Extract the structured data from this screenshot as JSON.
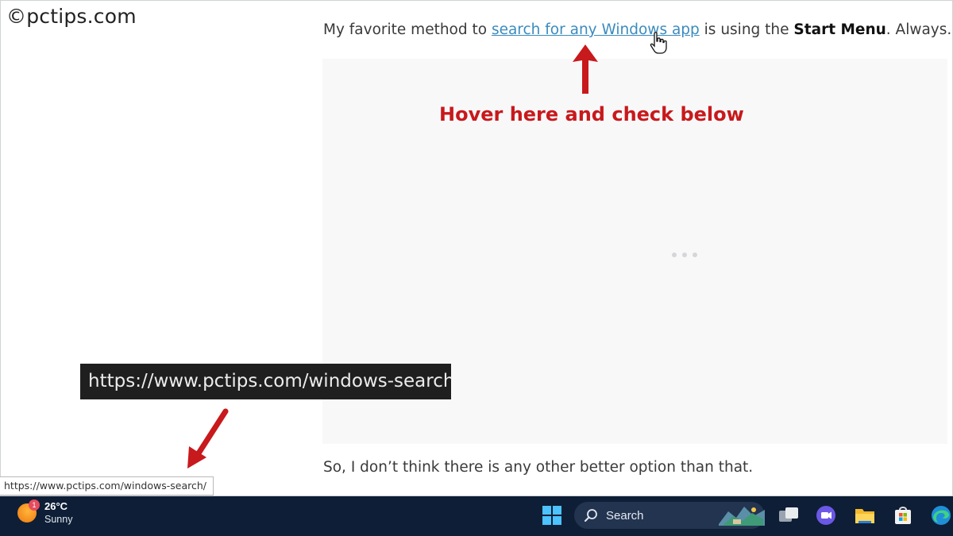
{
  "watermark": "©pctips.com",
  "article": {
    "para1_pre": "My favorite method to ",
    "para1_link": "search for any Windows app",
    "para1_mid": " is using the ",
    "para1_bold": "Start Menu",
    "para1_post": ". Always.",
    "para2": "So, I don’t think there is any other better option than that."
  },
  "annotation": {
    "hover_label": "Hover here and check below",
    "zoomed_url": "https://www.pctips.com/windows-search/",
    "color": "#c8191c"
  },
  "status_bar": {
    "url": "https://www.pctips.com/windows-search/"
  },
  "taskbar": {
    "weather_temp": "26°C",
    "weather_condition": "Sunny",
    "weather_badge": "1",
    "search_label": "Search",
    "icons": [
      "windows-start-icon",
      "search-icon",
      "task-view-icon",
      "chat-icon",
      "file-explorer-icon",
      "store-icon",
      "edge-icon"
    ]
  },
  "colors": {
    "link": "#3a8bbf",
    "taskbar": "#0e1e36",
    "ad_background": "#f8f8f9"
  }
}
